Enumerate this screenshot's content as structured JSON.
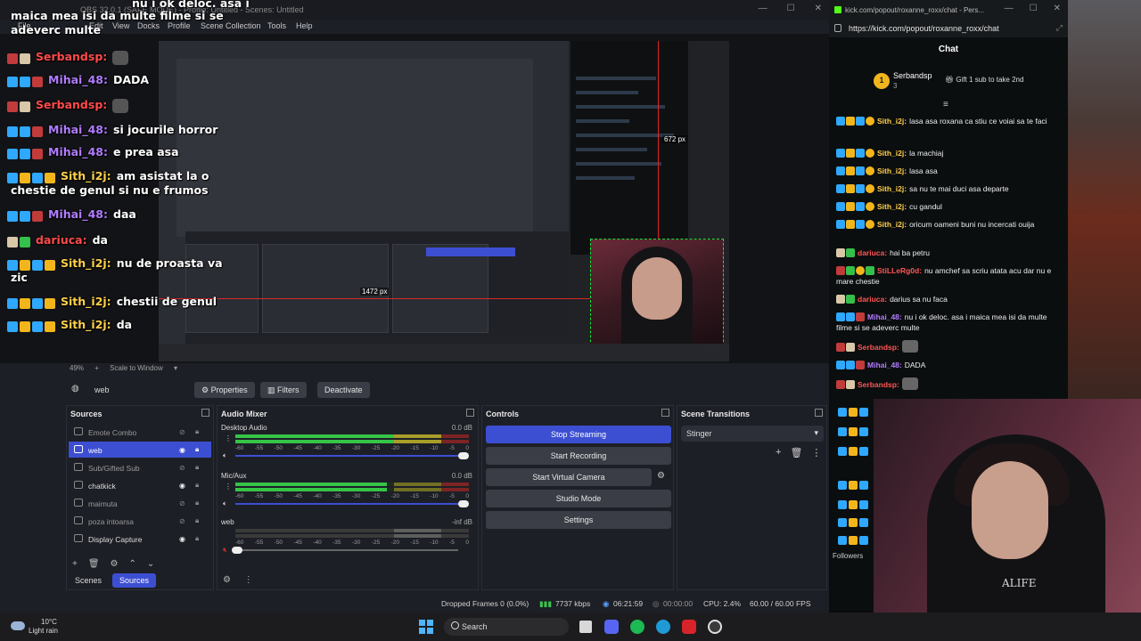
{
  "obs": {
    "title": "OBS 32.0.1 (SAFE MODE) - Profile: Untitled - Scenes: Untitled",
    "menu": [
      "File",
      "Edit",
      "View",
      "Docks",
      "Profile",
      "Scene Collection",
      "Tools",
      "Help"
    ],
    "preview": {
      "zoom": "49%",
      "scale_mode": "Scale to Window",
      "label_height": "672 px",
      "label_width": "1472 px"
    },
    "source_toolbar": {
      "source_name": "web",
      "properties": "Properties",
      "filters": "Filters",
      "deactivate": "Deactivate"
    },
    "sources": {
      "title": "Sources",
      "items": [
        {
          "label": "Emote Combo",
          "selected": false
        },
        {
          "label": "web",
          "selected": true
        },
        {
          "label": "Sub/Gifted Sub",
          "selected": false
        },
        {
          "label": "chatkick",
          "selected": false
        },
        {
          "label": "maimuta",
          "selected": false
        },
        {
          "label": "poza intoarsa",
          "selected": false
        },
        {
          "label": "Display Capture",
          "selected": false
        }
      ]
    },
    "tabs": {
      "scenes": "Scenes",
      "sources": "Sources"
    },
    "audio_mixer": {
      "title": "Audio Mixer",
      "scale": [
        "-60",
        "-55",
        "-50",
        "-45",
        "-40",
        "-35",
        "-30",
        "-25",
        "-20",
        "-15",
        "-10",
        "-5",
        "0"
      ],
      "channels": [
        {
          "name": "Desktop Audio",
          "db": "0.0 dB",
          "level": 0.85
        },
        {
          "name": "Mic/Aux",
          "db": "0.0 dB",
          "level": 0.65
        },
        {
          "name": "web",
          "db": "-inf dB",
          "level": 0.0
        }
      ]
    },
    "controls": {
      "title": "Controls",
      "stop_streaming": "Stop Streaming",
      "start_recording": "Start Recording",
      "start_virtual_camera": "Start Virtual Camera",
      "studio_mode": "Studio Mode",
      "settings": "Settings"
    },
    "scene_transitions": {
      "title": "Scene Transitions",
      "selected": "Stinger"
    },
    "status": {
      "dropped_frames": "Dropped Frames 0 (0.0%)",
      "bitrate": "7737 kbps",
      "stream_time": "06:21:59",
      "record_time": "00:00:00",
      "cpu": "CPU: 2.4%",
      "fps": "60.00 / 60.00 FPS"
    }
  },
  "overlay_chat": [
    {
      "user": "",
      "msg": "nu i ok deloc. asa i"
    },
    {
      "user": "",
      "msg": "maica mea isi da multe filme si se"
    },
    {
      "user": "",
      "msg": "adeverc multe"
    },
    {
      "user": "Serbandsp:",
      "msg": ""
    },
    {
      "user": "Mihai_48:",
      "msg": "DADA"
    },
    {
      "user": "Serbandsp:",
      "msg": ""
    },
    {
      "user": "Mihai_48:",
      "msg": "si jocurile horror"
    },
    {
      "user": "Mihai_48:",
      "msg": "e prea asa"
    },
    {
      "user": "Sith_i2j:",
      "msg": "am asistat la o"
    },
    {
      "user": "",
      "msg": "chestie de genul si nu e frumos"
    },
    {
      "user": "Mihai_48:",
      "msg": "daa"
    },
    {
      "user": "dariuca:",
      "msg": "da"
    },
    {
      "user": "Sith_i2j:",
      "msg": "nu de proasta va"
    },
    {
      "user": "",
      "msg": "zic"
    },
    {
      "user": "Sith_i2j:",
      "msg": "chestii de genul"
    },
    {
      "user": "Sith_i2j:",
      "msg": "da"
    }
  ],
  "browser": {
    "tab_title": "kick.com/popout/roxanne_roxx/chat - Pers...",
    "url": "https://kick.com/popout/roxanne_roxx/chat",
    "chat_header": "Chat",
    "pinned": {
      "badge": "1",
      "user": "Serbandsp",
      "sub_count": "3",
      "gift": "Gift 1 sub to take 2nd"
    },
    "messages": [
      {
        "user": "Sith_i2j:",
        "color": "#ffd04a",
        "text": "lasa asa roxana ca stiu ce voiai sa te faci"
      },
      {
        "user": "Sith_i2j:",
        "color": "#ffd04a",
        "text": "la machiaj"
      },
      {
        "user": "Sith_i2j:",
        "color": "#ffd04a",
        "text": "lasa asa"
      },
      {
        "user": "Sith_i2j:",
        "color": "#ffd04a",
        "text": "sa nu te mai duci asa departe"
      },
      {
        "user": "Sith_i2j:",
        "color": "#ffd04a",
        "text": "cu gandul"
      },
      {
        "user": "Sith_i2j:",
        "color": "#ffd04a",
        "text": "oricum oameni buni nu incercati ouija"
      },
      {
        "user": "dariuca:",
        "color": "#ff5555",
        "text": "hai ba petru"
      },
      {
        "user": "StiLLeRg0d:",
        "color": "#ff5555",
        "text": "nu amchef sa scriu atata acu dar nu e mare chestie"
      },
      {
        "user": "dariuca:",
        "color": "#ff5555",
        "text": "darius sa nu faca"
      },
      {
        "user": "Mihai_48:",
        "color": "#b07cff",
        "text": "nu i ok deloc. asa i maica mea isi da multe filme si se adeverc multe"
      },
      {
        "user": "Serbandsp:",
        "color": "#ff5555",
        "text": ""
      },
      {
        "user": "Mihai_48:",
        "color": "#b07cff",
        "text": "DADA"
      },
      {
        "user": "Serbandsp:",
        "color": "#ff5555",
        "text": ""
      }
    ],
    "followers": "Followers"
  },
  "cam": {
    "shirt_text": "ALIFE"
  },
  "taskbar": {
    "temp": "10°C",
    "weather": "Light rain",
    "search": "Search"
  },
  "colors": {
    "accent": "#3c4fd2",
    "kick_green": "#53fc18",
    "panel": "#1d1f26"
  }
}
